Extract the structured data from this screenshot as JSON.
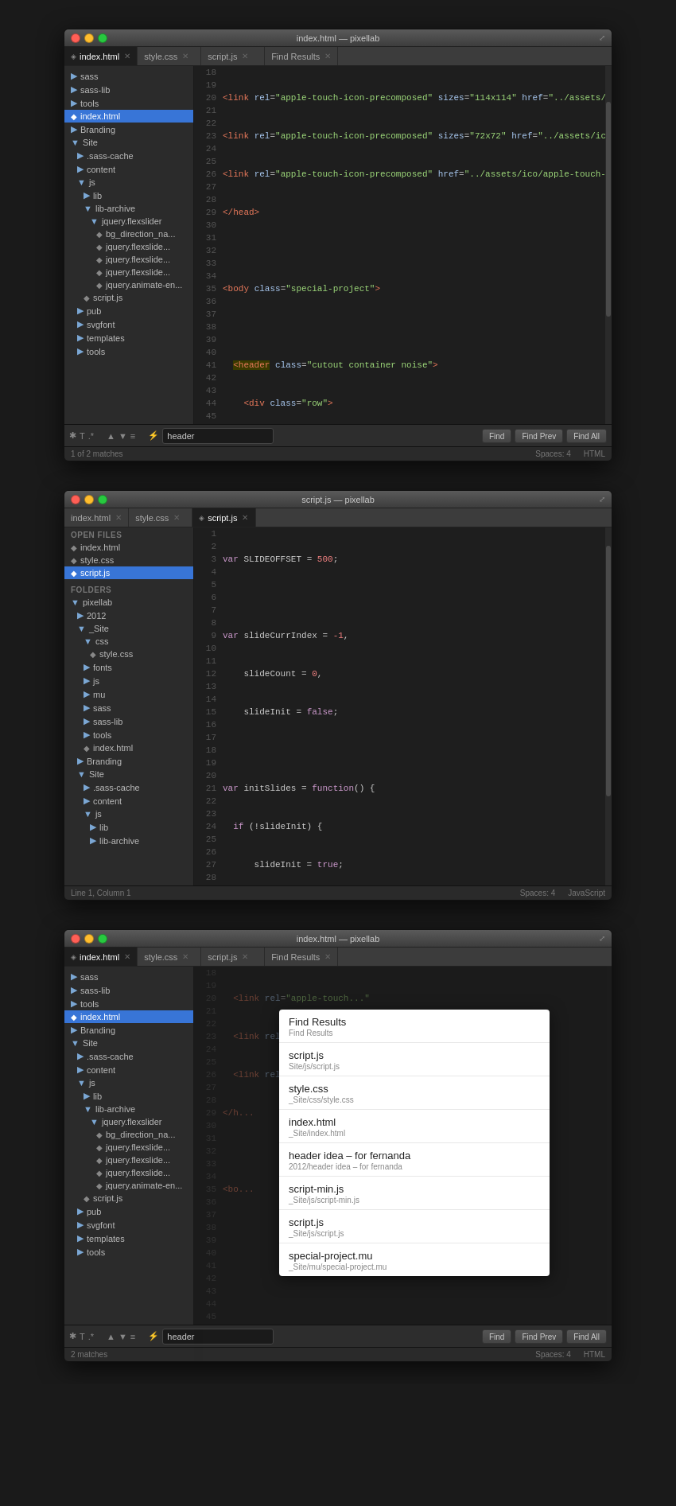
{
  "window1": {
    "titlebar": "index.html — pixellab",
    "tabs": [
      {
        "label": "index.html",
        "active": true
      },
      {
        "label": "style.css",
        "active": false
      },
      {
        "label": "script.js",
        "active": false
      },
      {
        "label": "Find Results",
        "active": false
      }
    ],
    "sidebar": [
      {
        "label": "sass",
        "type": "folder",
        "indent": 0
      },
      {
        "label": "sass-lib",
        "type": "folder",
        "indent": 0
      },
      {
        "label": "tools",
        "type": "folder",
        "indent": 0
      },
      {
        "label": "index.html",
        "type": "file",
        "indent": 0,
        "active": true
      },
      {
        "label": "Branding",
        "type": "folder",
        "indent": 0
      },
      {
        "label": "Site",
        "type": "folder",
        "indent": 0
      },
      {
        "label": ".sass-cache",
        "type": "folder",
        "indent": 1
      },
      {
        "label": "content",
        "type": "folder",
        "indent": 1
      },
      {
        "label": "js",
        "type": "folder",
        "indent": 1
      },
      {
        "label": "lib",
        "type": "folder",
        "indent": 2
      },
      {
        "label": "lib-archive",
        "type": "folder",
        "indent": 2
      },
      {
        "label": "jquery.flexslider",
        "type": "folder",
        "indent": 3
      },
      {
        "label": "bg_direction_na...",
        "type": "file",
        "indent": 4
      },
      {
        "label": "jquery.flexslide...",
        "type": "file",
        "indent": 4
      },
      {
        "label": "jquery.flexslide...",
        "type": "file",
        "indent": 4
      },
      {
        "label": "jquery.flexslide...",
        "type": "file",
        "indent": 4
      },
      {
        "label": "jquery.animate-en...",
        "type": "file",
        "indent": 4
      },
      {
        "label": "script.js",
        "type": "file",
        "indent": 2
      },
      {
        "label": "pub",
        "type": "folder",
        "indent": 1
      },
      {
        "label": "svgfont",
        "type": "folder",
        "indent": 1
      },
      {
        "label": "templates",
        "type": "folder",
        "indent": 1
      },
      {
        "label": "tools",
        "type": "folder",
        "indent": 1
      }
    ],
    "findbar": {
      "input": "header",
      "find": "Find",
      "find_prev": "Find Prev",
      "find_all": "Find All"
    },
    "statusbar": {
      "matches": "1 of 2 matches",
      "spaces": "Spaces: 4",
      "lang": "HTML"
    }
  },
  "window2": {
    "titlebar": "script.js — pixellab",
    "tabs": [
      {
        "label": "index.html",
        "active": false
      },
      {
        "label": "style.css",
        "active": false
      },
      {
        "label": "script.js",
        "active": true
      }
    ],
    "open_files_header": "OPEN FILES",
    "open_files": [
      {
        "label": "index.html"
      },
      {
        "label": "style.css"
      },
      {
        "label": "script.js",
        "active": true
      }
    ],
    "folders_header": "FOLDERS",
    "folders": [
      {
        "label": "pixellab",
        "type": "folder",
        "indent": 0
      },
      {
        "label": "2012",
        "type": "folder",
        "indent": 1
      },
      {
        "label": "_Site",
        "type": "folder",
        "indent": 1
      },
      {
        "label": "css",
        "type": "folder",
        "indent": 2
      },
      {
        "label": "style.css",
        "type": "file",
        "indent": 3
      },
      {
        "label": "fonts",
        "type": "folder",
        "indent": 2
      },
      {
        "label": "js",
        "type": "folder",
        "indent": 2
      },
      {
        "label": "mu",
        "type": "folder",
        "indent": 2
      },
      {
        "label": "sass",
        "type": "folder",
        "indent": 2
      },
      {
        "label": "sass-lib",
        "type": "folder",
        "indent": 2
      },
      {
        "label": "tools",
        "type": "folder",
        "indent": 2
      },
      {
        "label": "index.html",
        "type": "file",
        "indent": 2
      },
      {
        "label": "Branding",
        "type": "folder",
        "indent": 1
      },
      {
        "label": "Site",
        "type": "folder",
        "indent": 1
      },
      {
        "label": ".sass-cache",
        "type": "folder",
        "indent": 2
      },
      {
        "label": "content",
        "type": "folder",
        "indent": 2
      },
      {
        "label": "js",
        "type": "folder",
        "indent": 2
      },
      {
        "label": "lib",
        "type": "folder",
        "indent": 3
      },
      {
        "label": "lib-archive",
        "type": "folder",
        "indent": 3
      }
    ],
    "statusbar": {
      "line_col": "Line 1, Column 1",
      "spaces": "Spaces: 4",
      "lang": "JavaScript"
    }
  },
  "window3": {
    "titlebar": "index.html — pixellab",
    "tabs": [
      {
        "label": "index.html",
        "active": true
      },
      {
        "label": "style.css",
        "active": false
      },
      {
        "label": "script.js",
        "active": false
      },
      {
        "label": "Find Results",
        "active": false
      }
    ],
    "sidebar": [
      {
        "label": "sass",
        "type": "folder",
        "indent": 0
      },
      {
        "label": "sass-lib",
        "type": "folder",
        "indent": 0
      },
      {
        "label": "tools",
        "type": "folder",
        "indent": 0
      },
      {
        "label": "index.html",
        "type": "file",
        "indent": 0,
        "active": true
      },
      {
        "label": "Branding",
        "type": "folder",
        "indent": 0
      },
      {
        "label": "Site",
        "type": "folder",
        "indent": 0
      },
      {
        "label": ".sass-cache",
        "type": "folder",
        "indent": 1
      },
      {
        "label": "content",
        "type": "folder",
        "indent": 1
      },
      {
        "label": "js",
        "type": "folder",
        "indent": 1
      },
      {
        "label": "lib",
        "type": "folder",
        "indent": 2
      },
      {
        "label": "lib-archive",
        "type": "folder",
        "indent": 2
      },
      {
        "label": "jquery.flexslider",
        "type": "folder",
        "indent": 3
      },
      {
        "label": "bg_direction_na...",
        "type": "file",
        "indent": 4
      },
      {
        "label": "jquery.flexslide...",
        "type": "file",
        "indent": 4
      },
      {
        "label": "jquery.flexslide...",
        "type": "file",
        "indent": 4
      },
      {
        "label": "jquery.flexslide...",
        "type": "file",
        "indent": 4
      },
      {
        "label": "jquery.animate-en...",
        "type": "file",
        "indent": 4
      },
      {
        "label": "script.js",
        "type": "file",
        "indent": 2
      },
      {
        "label": "pub",
        "type": "folder",
        "indent": 1
      },
      {
        "label": "svgfont",
        "type": "folder",
        "indent": 1
      },
      {
        "label": "templates",
        "type": "folder",
        "indent": 1
      },
      {
        "label": "tools",
        "type": "folder",
        "indent": 1
      }
    ],
    "dropdown": {
      "items": [
        {
          "title": "Find Results",
          "sub": "Find Results"
        },
        {
          "title": "script.js",
          "sub": "Site/js/script.js"
        },
        {
          "title": "style.css",
          "sub": "_Site/css/style.css"
        },
        {
          "title": "index.html",
          "sub": "_Site/index.html"
        },
        {
          "title": "header idea – for fernanda",
          "sub": "2012/header idea – for fernanda"
        },
        {
          "title": "script-min.js",
          "sub": "_Site/js/script-min.js"
        },
        {
          "title": "script.js",
          "sub": "_Site/js/script.js"
        },
        {
          "title": "special-project.mu",
          "sub": "_Site/mu/special-project.mu"
        }
      ]
    },
    "findbar": {
      "input": "header",
      "find": "Find",
      "find_prev": "Find Prev",
      "find_all": "Find All"
    },
    "statusbar": {
      "matches": "2 matches",
      "spaces": "Spaces: 4",
      "lang": "HTML"
    }
  }
}
